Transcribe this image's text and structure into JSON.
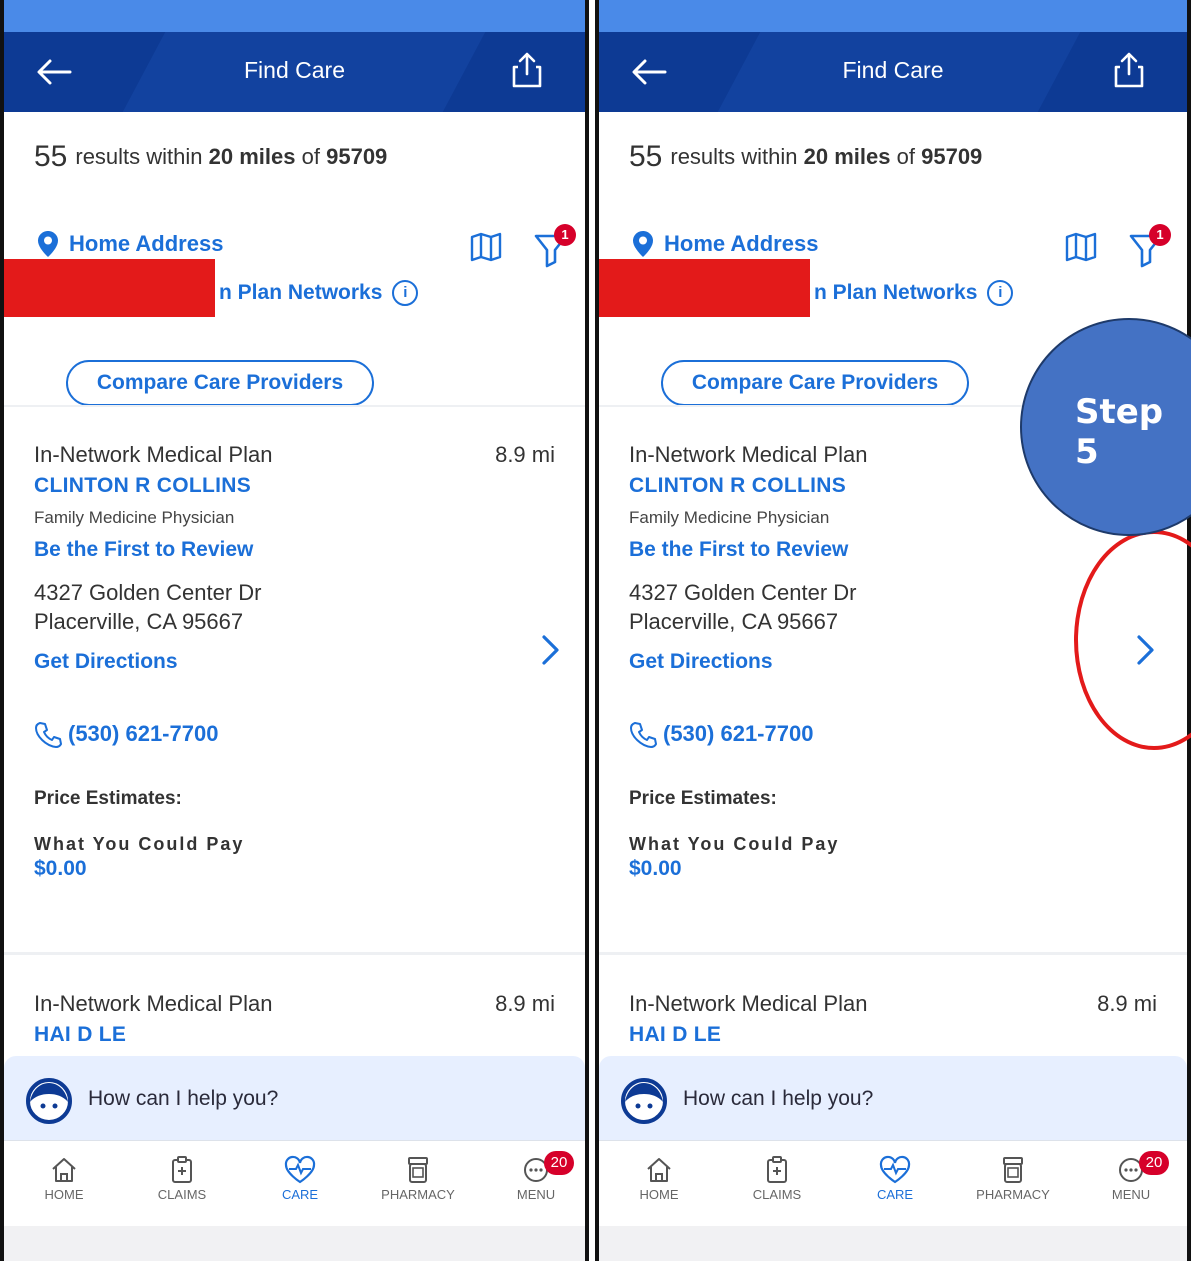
{
  "header": {
    "title": "Find Care"
  },
  "results": {
    "count": "55",
    "pre": "results within",
    "radius": "20 miles",
    "of": "of",
    "zip": "95709"
  },
  "location": {
    "label": "Home Address"
  },
  "filter": {
    "badge": "1"
  },
  "networks": {
    "visible_fragment": "n",
    "label": "Plan Networks",
    "info": "i"
  },
  "compare": {
    "label": "Compare Care Providers"
  },
  "providers": [
    {
      "plan": "In-Network Medical Plan",
      "distance": "8.9 mi",
      "name": "CLINTON R COLLINS",
      "specialty": "Family Medicine Physician",
      "review": "Be the First to Review",
      "address1": "4327 Golden Center Dr",
      "address2": "Placerville, CA 95667",
      "directions": "Get Directions",
      "phone": "(530) 621-7700",
      "price_heading": "Price Estimates:",
      "price_label": "What You Could Pay",
      "price": "$0.00"
    },
    {
      "plan": "In-Network Medical Plan",
      "distance": "8.9 mi",
      "name": "HAI D LE"
    }
  ],
  "assistant": {
    "prompt": "How can I help you?"
  },
  "tabs": [
    {
      "label": "HOME",
      "icon": "home-icon"
    },
    {
      "label": "CLAIMS",
      "icon": "clipboard-icon"
    },
    {
      "label": "CARE",
      "icon": "heart-pulse-icon",
      "active": true
    },
    {
      "label": "PHARMACY",
      "icon": "pill-bottle-icon"
    },
    {
      "label": "MENU",
      "icon": "menu-icon",
      "badge": "20"
    }
  ],
  "annotation": {
    "step": "Step 5"
  },
  "colors": {
    "header": "#0d3a94",
    "accent": "#1b6fd8",
    "badge": "#d6002a",
    "annotation_fill": "#4472c4",
    "highlight": "#e31a1a"
  }
}
